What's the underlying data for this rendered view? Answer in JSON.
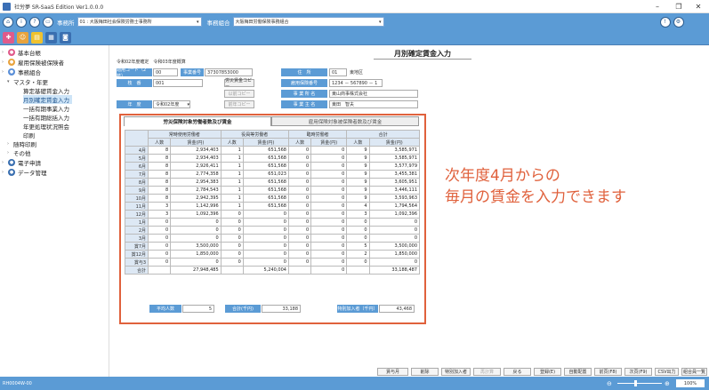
{
  "window": {
    "title": "社労夢 SR-SaaS Edition Ver1.0.0.0"
  },
  "toolbar": {
    "office_label": "事務所",
    "office_value": "01 : 大阪梅田社会保険労務士事務所",
    "union_label": "事務組合",
    "union_value": "大阪梅田労働保険事務組合"
  },
  "sidebar": {
    "items": [
      {
        "label": "基本台帳",
        "level": 0,
        "icon": "book-icon",
        "color": "#e05a8a"
      },
      {
        "label": "雇用保険被保険者",
        "level": 0,
        "icon": "person-icon",
        "color": "#e8a33d"
      },
      {
        "label": "事務組合",
        "level": 0,
        "icon": "building-icon",
        "color": "#5a8fd8"
      },
      {
        "label": "マスタ・年更",
        "level": 1,
        "icon": "",
        "color": ""
      },
      {
        "label": "算定基礎賃金入力",
        "level": 2,
        "icon": "",
        "color": ""
      },
      {
        "label": "月別確定賃金入力",
        "level": 2,
        "icon": "",
        "color": "",
        "selected": true
      },
      {
        "label": "一括有期事業入力",
        "level": 2,
        "icon": "",
        "color": ""
      },
      {
        "label": "一括有期総括入力",
        "level": 2,
        "icon": "",
        "color": ""
      },
      {
        "label": "年更処理状況照会",
        "level": 2,
        "icon": "",
        "color": ""
      },
      {
        "label": "印刷",
        "level": 2,
        "icon": "",
        "color": ""
      },
      {
        "label": "随時印刷",
        "level": 1,
        "icon": "",
        "color": ""
      },
      {
        "label": "その他",
        "level": 1,
        "icon": "",
        "color": ""
      },
      {
        "label": "電子申請",
        "level": 0,
        "icon": "upload-icon",
        "color": "#3a6fb0"
      },
      {
        "label": "データ管理",
        "level": 0,
        "icon": "database-icon",
        "color": "#3a6fb0"
      }
    ]
  },
  "form": {
    "page_title": "月別確定賃金入力",
    "period_text": "令和02年度確定　令和03年度概算",
    "insurance_code_label": "適用コード（2枝）",
    "insurance_code_value": "00",
    "employer_no_label": "事業番号",
    "employer_no_value": "37307853000",
    "branch_label": "枝　番",
    "branch_value": "001",
    "copy_btn": "労災賃金コピー",
    "copy_btn2": "以前コピー",
    "copy_btn3": "前年コピー",
    "year_label": "年　度",
    "year_value": "令和02年度",
    "pref_label": "住　所",
    "pref_value": "01",
    "pref_name": "東地区",
    "emp_ins_label": "雇用保険番号",
    "emp_ins_value": "1234 － 567890 － 1",
    "company_label": "事 業 所 名",
    "company_value": "東山商事株式会社",
    "owner_label": "事 業 主 名",
    "owner_value": "東田　智夫"
  },
  "tabs": [
    {
      "label": "労災保険対象労働者数及び賃金",
      "active": true
    },
    {
      "label": "雇用保険対象被保険者数及び賃金",
      "active": false
    }
  ],
  "grid": {
    "group_headers": [
      "常時使用労働者",
      "役員等労働者",
      "臨時労働者",
      "合計"
    ],
    "sub_headers": [
      "人数",
      "賃金(円)",
      "人数",
      "賃金(円)",
      "人数",
      "賃金(円)",
      "人数",
      "賃金(円)"
    ],
    "rows": [
      {
        "month": "4月",
        "v": [
          "8",
          "2,934,403",
          "1",
          "651,568",
          "0",
          "0",
          "9",
          "3,585,971"
        ]
      },
      {
        "month": "5月",
        "v": [
          "8",
          "2,934,403",
          "1",
          "651,568",
          "0",
          "0",
          "9",
          "3,585,971"
        ]
      },
      {
        "month": "6月",
        "v": [
          "8",
          "2,926,411",
          "1",
          "651,568",
          "0",
          "0",
          "9",
          "3,577,979"
        ]
      },
      {
        "month": "7月",
        "v": [
          "8",
          "2,774,358",
          "1",
          "651,023",
          "0",
          "0",
          "9",
          "3,455,381"
        ]
      },
      {
        "month": "8月",
        "v": [
          "8",
          "2,954,383",
          "1",
          "651,568",
          "0",
          "0",
          "9",
          "3,605,951"
        ]
      },
      {
        "month": "9月",
        "v": [
          "8",
          "2,784,543",
          "1",
          "651,568",
          "0",
          "0",
          "9",
          "3,446,111"
        ]
      },
      {
        "month": "10月",
        "v": [
          "8",
          "2,942,395",
          "1",
          "651,568",
          "0",
          "0",
          "9",
          "3,593,963"
        ]
      },
      {
        "month": "11月",
        "v": [
          "3",
          "1,142,996",
          "1",
          "651,568",
          "0",
          "0",
          "4",
          "1,794,564"
        ]
      },
      {
        "month": "12月",
        "v": [
          "3",
          "1,092,396",
          "0",
          "0",
          "0",
          "0",
          "3",
          "1,092,396"
        ]
      },
      {
        "month": "1月",
        "v": [
          "0",
          "0",
          "0",
          "0",
          "0",
          "0",
          "0",
          "0"
        ]
      },
      {
        "month": "2月",
        "v": [
          "0",
          "0",
          "0",
          "0",
          "0",
          "0",
          "0",
          "0"
        ]
      },
      {
        "month": "3月",
        "v": [
          "0",
          "0",
          "0",
          "0",
          "0",
          "0",
          "0",
          "0"
        ]
      },
      {
        "month": "賞7月",
        "v": [
          "0",
          "3,500,000",
          "0",
          "0",
          "0",
          "0",
          "5",
          "3,500,000"
        ]
      },
      {
        "month": "賞12月",
        "v": [
          "0",
          "1,850,000",
          "0",
          "0",
          "0",
          "0",
          "2",
          "1,850,000"
        ]
      },
      {
        "month": "賞与3",
        "v": [
          "0",
          "0",
          "0",
          "0",
          "0",
          "0",
          "0",
          "0"
        ]
      }
    ],
    "total_row": {
      "month": "合計",
      "v": [
        "",
        "27,948,485",
        "",
        "5,240,004",
        "",
        "0",
        "",
        "33,188,487"
      ]
    },
    "avg_label": "平均人数",
    "avg_value": "5",
    "total_k_label": "合計(千円)",
    "total_k_value": "33,188",
    "special_label": "特別加入者（千円）",
    "special_value": "43,468"
  },
  "callout": {
    "line1": "次年度4月からの",
    "line2": "毎月の賃金を入力できます"
  },
  "bottom_buttons": [
    "賃与月",
    "削除",
    "特別加入者",
    "再計算",
    "戻る",
    "登録(E)",
    "自動配置",
    "前頁(F8)",
    "次頁(F9)",
    "CSV出力",
    "組合員一覧"
  ],
  "status": {
    "left": "RH0004W-00",
    "zoom": "100%"
  }
}
